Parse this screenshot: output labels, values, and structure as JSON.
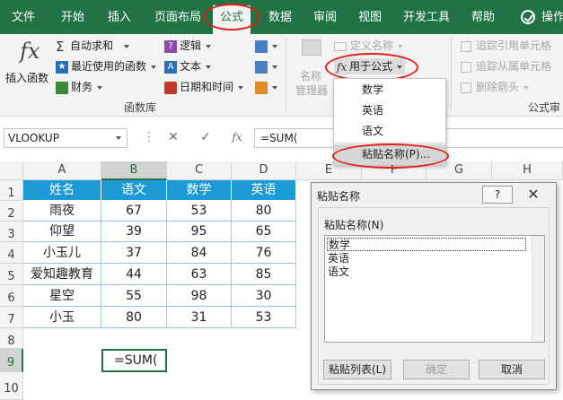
{
  "tabs": [
    {
      "label": "文件"
    },
    {
      "label": "开始"
    },
    {
      "label": "插入"
    },
    {
      "label": "页面布局"
    },
    {
      "label": "公式"
    },
    {
      "label": "数据"
    },
    {
      "label": "审阅"
    },
    {
      "label": "视图"
    },
    {
      "label": "开发工具"
    },
    {
      "label": "帮助"
    },
    {
      "label": "操作"
    }
  ],
  "ribbon": {
    "insert_function": "插入函数",
    "autosum": "自动求和",
    "recent": "最近使用的函数",
    "financial": "财务",
    "logical": "逻辑",
    "text": "文本",
    "datetime": "日期和时间",
    "group_function_library": "函数库",
    "name_manager_line1": "名称",
    "name_manager_line2": "管理器",
    "define_name": "定义名称",
    "use_in_formula": "用于公式",
    "trace_precedents": "追踪引用单元格",
    "trace_dependents": "追踪从属单元格",
    "remove_arrows": "删除箭头",
    "group_formula_audit": "公式审"
  },
  "formula_bar": {
    "name_box": "VLOOKUP",
    "cancel": "✕",
    "enter": "✓",
    "fx": "fx",
    "formula": "=SUM("
  },
  "columns": [
    "A",
    "B",
    "C",
    "D",
    "E",
    "F",
    "G",
    "H"
  ],
  "rows": [
    "1",
    "2",
    "3",
    "4",
    "5",
    "6",
    "7",
    "8",
    "9",
    "10"
  ],
  "table": {
    "headers": [
      "姓名",
      "语文",
      "数学",
      "英语"
    ],
    "rows": [
      [
        "雨夜",
        "67",
        "53",
        "80"
      ],
      [
        "仰望",
        "39",
        "95",
        "65"
      ],
      [
        "小玉儿",
        "37",
        "84",
        "76"
      ],
      [
        "爱知趣教育",
        "44",
        "63",
        "85"
      ],
      [
        "星空",
        "55",
        "98",
        "30"
      ],
      [
        "小玉",
        "80",
        "31",
        "53"
      ]
    ]
  },
  "active_cell_text": "=SUM(",
  "menu": {
    "items": [
      "数学",
      "英语",
      "语文"
    ],
    "paste_names": "粘贴名称(P)..."
  },
  "dialog": {
    "title": "粘贴名称",
    "help": "?",
    "close": "✕",
    "label": "粘贴名称(N)",
    "list": [
      "数学",
      "英语",
      "语文"
    ],
    "paste_list": "粘贴列表(L)",
    "ok": "确定",
    "cancel": "取消"
  },
  "colors": {
    "ribbon_green": "#217346",
    "header_blue": "#1c9ad6",
    "highlight_red": "#e0201b"
  }
}
